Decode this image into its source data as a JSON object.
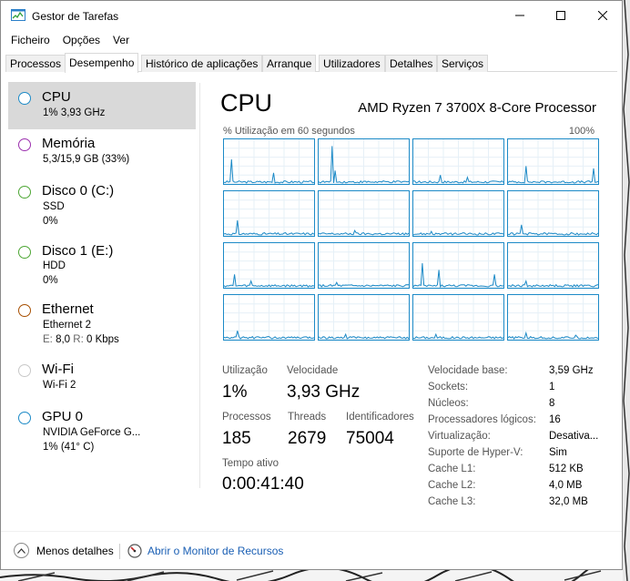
{
  "window": {
    "title": "Gestor de Tarefas"
  },
  "menu": [
    "Ficheiro",
    "Opções",
    "Ver"
  ],
  "tabs": [
    "Processos",
    "Desempenho",
    "Histórico de aplicações",
    "Arranque",
    "Utilizadores",
    "Detalhes",
    "Serviços"
  ],
  "sidebar": {
    "items": [
      {
        "title": "CPU",
        "sub1": "1% 3,93 GHz",
        "color": "#1c8ac7"
      },
      {
        "title": "Memória",
        "sub1": "5,3/15,9 GB (33%)",
        "color": "#9b2fae"
      },
      {
        "title": "Disco 0 (C:)",
        "sub1": "SSD",
        "sub2": "0%",
        "color": "#4da634"
      },
      {
        "title": "Disco 1 (E:)",
        "sub1": "HDD",
        "sub2": "0%",
        "color": "#4da634"
      },
      {
        "title": "Ethernet",
        "sub1": "Ethernet 2",
        "sub2_e_label": "E:",
        "sub2_e_value": "8,0",
        "sub2_r_label": "R:",
        "sub2_r_value": "0 Kbps",
        "color": "#a74f01"
      },
      {
        "title": "Wi-Fi",
        "sub1": "Wi-Fi 2",
        "color": "#c8c8c8"
      },
      {
        "title": "GPU 0",
        "sub1": "NVIDIA GeForce G...",
        "sub2": "1% (41° C)",
        "color": "#1c8ac7"
      }
    ]
  },
  "main": {
    "title": "CPU",
    "model": "AMD Ryzen 7 3700X 8-Core Processor",
    "graph_label": "% Utilização em 60 segundos",
    "graph_max": "100%",
    "stats": {
      "utilization_label": "Utilização",
      "utilization_value": "1%",
      "speed_label": "Velocidade",
      "speed_value": "3,93 GHz",
      "processes_label": "Processos",
      "processes_value": "185",
      "threads_label": "Threads",
      "threads_value": "2679",
      "handles_label": "Identificadores",
      "handles_value": "75004",
      "uptime_label": "Tempo ativo",
      "uptime_value": "0:00:41:40"
    },
    "specs": [
      {
        "label": "Velocidade base:",
        "value": "3,59 GHz"
      },
      {
        "label": "Sockets:",
        "value": "1"
      },
      {
        "label": "Núcleos:",
        "value": "8"
      },
      {
        "label": "Processadores lógicos:",
        "value": "16"
      },
      {
        "label": "Virtualização:",
        "value": "Desativa..."
      },
      {
        "label": "Suporte de Hyper-V:",
        "value": "Sim"
      },
      {
        "label": "Cache L1:",
        "value": "512 KB"
      },
      {
        "label": "Cache L2:",
        "value": "4,0 MB"
      },
      {
        "label": "Cache L3:",
        "value": "32,0 MB"
      }
    ]
  },
  "footer": {
    "less_details": "Menos detalhes",
    "resource_monitor": "Abrir o Monitor de Recursos"
  },
  "colors": {
    "accent": "#1c8ac7",
    "graph_fill": "#f1f6fa",
    "link": "#1a5fb4",
    "selected": "#d9d9d9"
  }
}
